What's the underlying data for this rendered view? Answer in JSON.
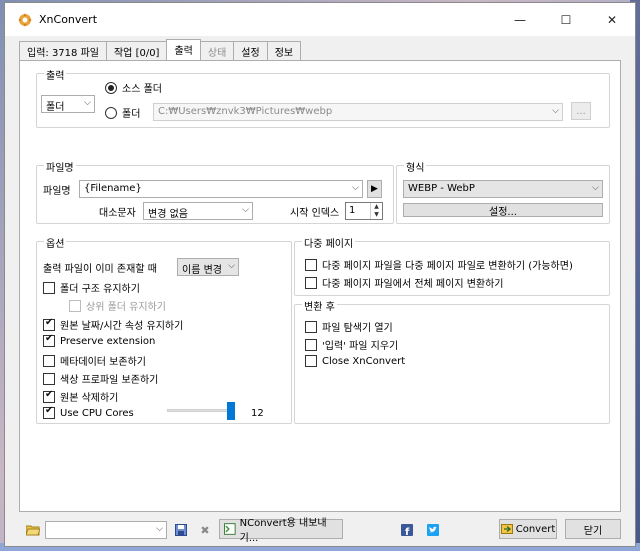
{
  "window": {
    "title": "XnConvert",
    "controls": {
      "minimize": "—",
      "maximize": "☐",
      "close": "✕"
    }
  },
  "tabs": [
    {
      "label": "입력: 3718 파일",
      "state": "normal"
    },
    {
      "label": "작업 [0/0]",
      "state": "normal"
    },
    {
      "label": "출력",
      "state": "active"
    },
    {
      "label": "상태",
      "state": "disabled"
    },
    {
      "label": "설정",
      "state": "normal"
    },
    {
      "label": "정보",
      "state": "normal"
    }
  ],
  "output_group": {
    "label": "출력",
    "destination_combo": "폴더",
    "radio_source_folder": "소스 폴더",
    "radio_folder": "폴더",
    "folder_path": "C:₩Users₩znvk3₩Pictures₩webp",
    "browse_label": "..."
  },
  "filename_group": {
    "label": "파일명",
    "filename_label": "파일명",
    "filename_value": "{Filename}",
    "case_label": "대소문자",
    "case_value": "변경 없음",
    "start_index_label": "시작 인덱스",
    "start_index_value": "1"
  },
  "format_group": {
    "label": "형식",
    "format_value": "WEBP - WebP",
    "settings_label": "설정..."
  },
  "options_group": {
    "label": "옵션",
    "exists_label": "출력 파일이 이미 존재할 때",
    "exists_value": "이름 변경",
    "keep_folder_structure": {
      "label": "폴더 구조 유지하기",
      "checked": false
    },
    "keep_parent_folder": {
      "label": "상위 폴더 유지하기",
      "checked": false,
      "disabled": true
    },
    "keep_datetime": {
      "label": "원본 날짜/시간 속성 유지하기",
      "checked": true
    },
    "preserve_extension": {
      "label": "Preserve extension",
      "checked": true
    },
    "keep_metadata": {
      "label": "메타데이터 보존하기",
      "checked": false
    },
    "keep_color_profile": {
      "label": "색상 프로파일 보존하기",
      "checked": false
    },
    "delete_original": {
      "label": "원본 삭제하기",
      "checked": true
    },
    "use_cpu_cores": {
      "label": "Use CPU Cores",
      "checked": true,
      "value": "12",
      "level": 1.0
    }
  },
  "multipage_group": {
    "label": "다중 페이지",
    "multi_to_multi": {
      "label": "다중 페이지 파일을 다중 페이지 파일로 변환하기 (가능하면)",
      "checked": false
    },
    "multi_to_all": {
      "label": "다중 페이지 파일에서 전체 페이지 변환하기",
      "checked": false
    }
  },
  "after_group": {
    "label": "변환 후",
    "open_explorer": {
      "label": "파일 탐색기 열기",
      "checked": false
    },
    "delete_input": {
      "label": "'입력' 파일 지우기",
      "checked": false
    },
    "close_app": {
      "label": "Close XnConvert",
      "checked": false
    }
  },
  "bottom": {
    "preset_value": "",
    "export_label": "NConvert용 내보내기...",
    "convert_label": "Convert",
    "close_label": "닫기"
  },
  "colors": {
    "accent": "#0078d7",
    "facebook": "#3b5998",
    "twitter": "#1da1f2"
  }
}
